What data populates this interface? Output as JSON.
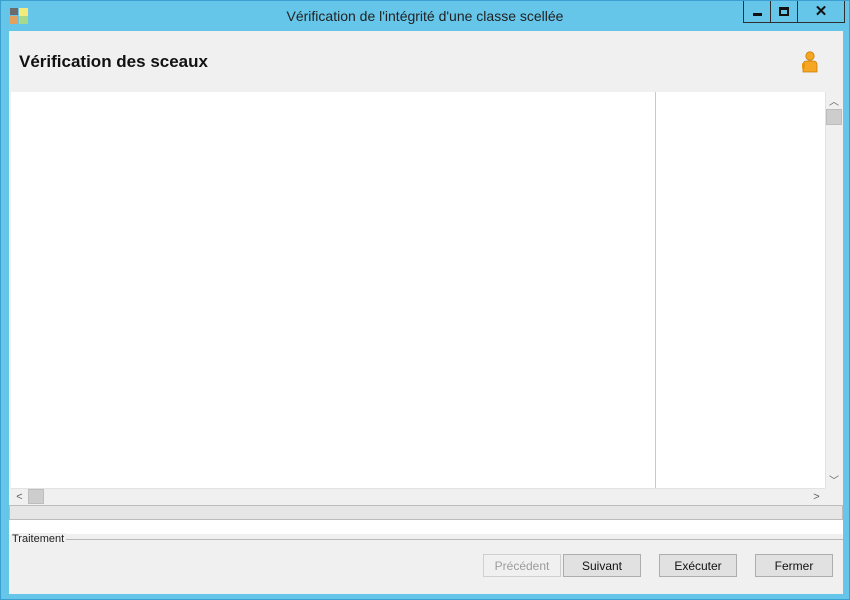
{
  "window": {
    "title": "Vérification de l'intégrité d'une classe scellée",
    "controls": {
      "minimize": "minimize-icon",
      "maximize": "maximize-icon",
      "close": "close-icon"
    }
  },
  "header": {
    "title": "Vérification des sceaux",
    "icon": "user-icon"
  },
  "progress": {
    "value_percent": 0
  },
  "group": {
    "label": "Traitement"
  },
  "buttons": {
    "previous": {
      "label": "Précédent",
      "enabled": false
    },
    "next": {
      "label": "Suivant",
      "enabled": true
    },
    "execute": {
      "label": "Exécuter",
      "enabled": true
    },
    "close": {
      "label": "Fermer",
      "enabled": true
    }
  },
  "colors": {
    "title_bar": "#66c6ea",
    "client_background": "#f0f0f0",
    "user_icon": "#f5a623"
  }
}
